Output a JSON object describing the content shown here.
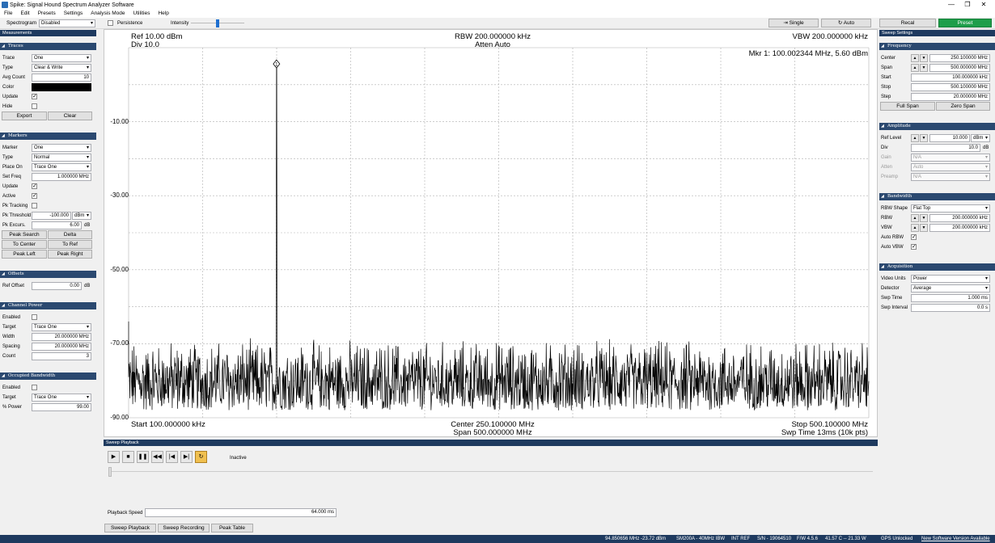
{
  "window": {
    "title": "Spike: Signal Hound Spectrum Analyzer Software"
  },
  "menu": [
    "File",
    "Edit",
    "Presets",
    "Settings",
    "Analysis Mode",
    "Utilities",
    "Help"
  ],
  "toolbar": {
    "spectrogram_label": "Spectrogram",
    "spectrogram_value": "Disabled",
    "persistence_label": "Persistence",
    "intensity_label": "Intensity",
    "intensity_level": 0.5,
    "single_label": "Single",
    "auto_label": "Auto",
    "recal_label": "Recal",
    "preset_label": "Preset"
  },
  "left": {
    "title": "Measurements",
    "traces": {
      "header": "Traces",
      "trace_label": "Trace",
      "trace_value": "One",
      "type_label": "Type",
      "type_value": "Clear & Write",
      "avg_label": "Avg Count",
      "avg_value": "10",
      "color_label": "Color",
      "update_label": "Update",
      "hide_label": "Hide",
      "export_label": "Export",
      "clear_label": "Clear"
    },
    "markers": {
      "header": "Markers",
      "marker_label": "Marker",
      "marker_value": "One",
      "type_label": "Type",
      "type_value": "Normal",
      "placeon_label": "Place On",
      "placeon_value": "Trace One",
      "setfreq_label": "Set Freq",
      "setfreq_value": "1.000000 MHz",
      "update_label": "Update",
      "active_label": "Active",
      "pktrack_label": "Pk Tracking",
      "pkthresh_label": "Pk Threshold",
      "pkthresh_value": "-100.000",
      "pkthresh_unit": "dBm",
      "pkexc_label": "Pk Excurs.",
      "pkexc_value": "6.00",
      "pkexc_unit": "dB",
      "peaksearch": "Peak Search",
      "delta": "Delta",
      "tocenter": "To Center",
      "toref": "To Ref",
      "peakleft": "Peak Left",
      "peakright": "Peak Right"
    },
    "offsets": {
      "header": "Offsets",
      "refoff_label": "Ref Offset",
      "refoff_value": "0.00",
      "refoff_unit": "dB"
    },
    "chpower": {
      "header": "Channel Power",
      "enabled_label": "Enabled",
      "target_label": "Target",
      "target_value": "Trace One",
      "width_label": "Width",
      "width_value": "20.000000 MHz",
      "spacing_label": "Spacing",
      "spacing_value": "20.000000 MHz",
      "count_label": "Count",
      "count_value": "3"
    },
    "occbw": {
      "header": "Occupied Bandwidth",
      "enabled_label": "Enabled",
      "target_label": "Target",
      "target_value": "Trace One",
      "power_label": "% Power",
      "power_value": "99.00"
    }
  },
  "plot": {
    "ref": "Ref 10.00 dBm",
    "div": "Div 10.0",
    "rbw": "RBW 200.000000 kHz",
    "atten": "Atten Auto",
    "vbw": "VBW 200.000000 kHz",
    "marker": "Mkr 1: 100.002344 MHz, 5.60 dBm",
    "start": "Start 100.000000 kHz",
    "center": "Center 250.100000 MHz",
    "span": "Span 500.000000 MHz",
    "stop": "Stop 500.100000 MHz",
    "swp": "Swp Time 13ms (10k pts)",
    "marker_num": "1"
  },
  "chart_data": {
    "type": "line",
    "x_start_mhz": 0.1,
    "x_stop_mhz": 500.1,
    "ylim": [
      -90,
      10
    ],
    "y_ticks": [
      "-10.00",
      "-30.00",
      "-50.00",
      "-70.00",
      "-90.00"
    ],
    "y_tick_values": [
      -10,
      -30,
      -50,
      -70,
      -90
    ],
    "peak": {
      "x_mhz": 100.002344,
      "y_dbm": 5.6
    },
    "noise_floor_dbm": [
      -88,
      -68
    ],
    "grid": true
  },
  "right": {
    "title": "Sweep Settings",
    "freq": {
      "header": "Frequency",
      "center_label": "Center",
      "center_value": "250.100000 MHz",
      "span_label": "Span",
      "span_value": "500.000000 MHz",
      "start_label": "Start",
      "start_value": "100.000000 kHz",
      "stop_label": "Stop",
      "stop_value": "500.100000 MHz",
      "step_label": "Step",
      "step_value": "20.000000 MHz",
      "fullspan": "Full Span",
      "zerospan": "Zero Span"
    },
    "amp": {
      "header": "Amplitude",
      "ref_label": "Ref Level",
      "ref_value": "10.000",
      "ref_unit": "dBm",
      "div_label": "Div",
      "div_value": "10.0",
      "div_unit": "dB",
      "gain_label": "Gain",
      "gain_value": "N/A",
      "atten_label": "Atten",
      "atten_value": "Auto",
      "preamp_label": "Preamp",
      "preamp_value": "N/A"
    },
    "bw": {
      "header": "Bandwidth",
      "shape_label": "RBW Shape",
      "shape_value": "Flat Top",
      "rbw_label": "RBW",
      "rbw_value": "200.000000 kHz",
      "vbw_label": "VBW",
      "vbw_value": "200.000000 kHz",
      "autorbw_label": "Auto RBW",
      "autovbw_label": "Auto VBW"
    },
    "acq": {
      "header": "Acquisition",
      "vu_label": "Video Units",
      "vu_value": "Power",
      "det_label": "Detector",
      "det_value": "Average",
      "swpt_label": "Swp Time",
      "swpt_value": "1.000 ms",
      "swpi_label": "Swp Interval",
      "swpi_value": "0.0 s"
    }
  },
  "playback": {
    "title": "Sweep Playback",
    "state": "Inactive",
    "speed_label": "Playback Speed",
    "speed_value": "64.000 ms",
    "tab1": "Sweep Playback",
    "tab2": "Sweep Recording",
    "tab3": "Peak Table"
  },
  "status": {
    "s1": "94.850656 MHz -23.72 dBm",
    "s2": "SM200A - 40MHz IBW",
    "s3": "INT REF",
    "s4": "S/N - 19064510",
    "s5": "F/W 4.5.6",
    "s6": "41.57 C -- 21.33 W",
    "s7": "GPS Unlocked",
    "s8": "New Software Version Available"
  }
}
